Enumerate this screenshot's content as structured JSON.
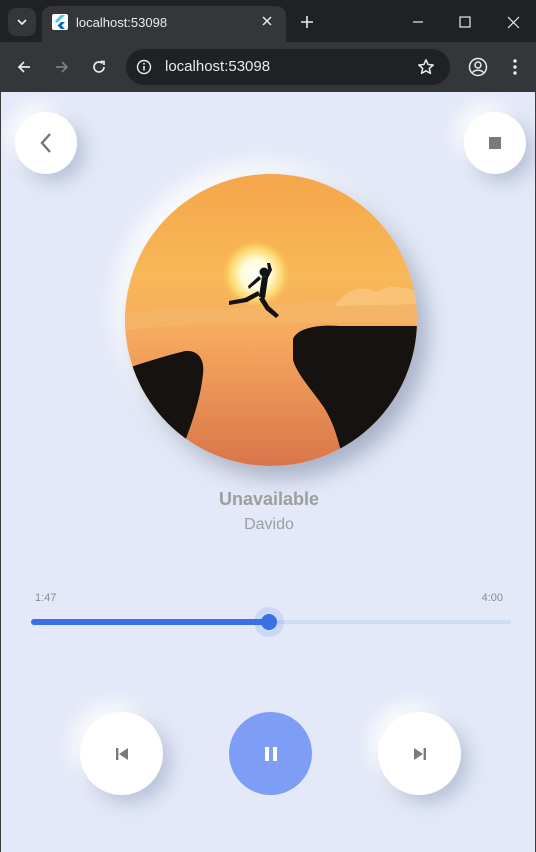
{
  "browser": {
    "tab_title": "localhost:53098",
    "url": "localhost:53098"
  },
  "player": {
    "song_title": "Unavailable",
    "artist": "Davido",
    "elapsed": "1:47",
    "duration": "4:00",
    "progress_fraction": 0.4958,
    "state": "playing"
  },
  "colors": {
    "page_background": "#e3e9f8",
    "accent": "#3b6fe6",
    "play_button": "#7e9ef5",
    "text_muted": "#9e9e9e"
  },
  "icons": {
    "back": "chevron-left-icon",
    "stop": "stop-icon",
    "previous": "skip-previous-icon",
    "play_pause": "pause-icon",
    "next": "skip-next-icon"
  }
}
